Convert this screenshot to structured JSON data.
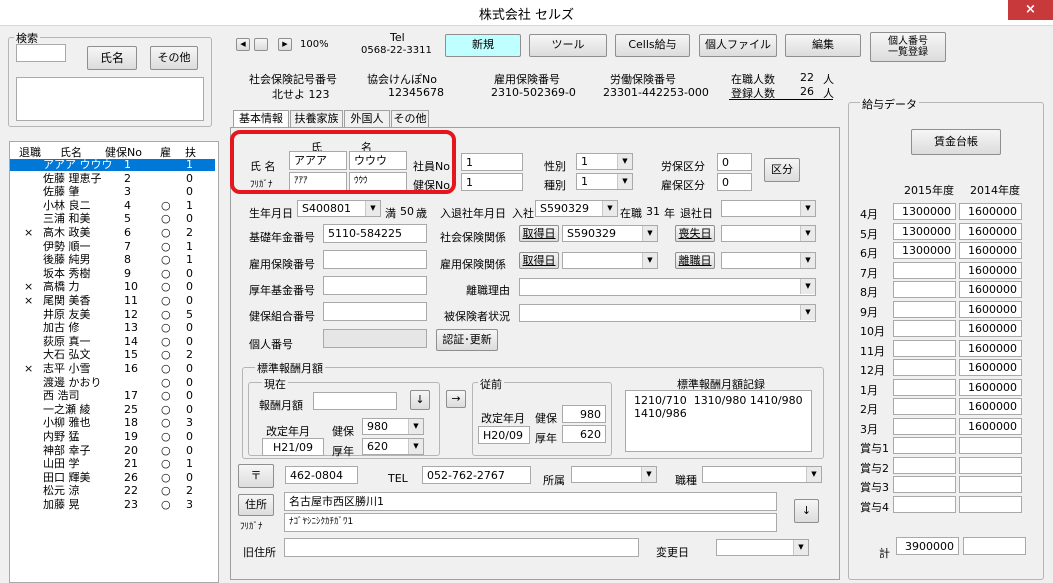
{
  "window": {
    "title": "株式会社 セルズ",
    "close": "×"
  },
  "search": {
    "group_label": "検索",
    "name_button": "氏名",
    "other_button": "その他"
  },
  "nav": {
    "first": "◀",
    "prev": "▏",
    "next": "▶",
    "zoom": "100%"
  },
  "tel": {
    "label": "Tel",
    "number": "0568-22-3311"
  },
  "toolbar": {
    "new": "新規",
    "tool": "ツール",
    "cells": "Cells給与",
    "personal_file": "個人ファイル",
    "edit": "編集",
    "mynumber": "個人番号\n一覧登録"
  },
  "company": {
    "shaho_label": "社会保険記号番号",
    "shaho_value": "北せよ 123",
    "kyokai_label": "協会けんぽNo",
    "kyokai_value": "12345678",
    "koyo_label": "雇用保険番号",
    "koyo_value": "2310-502369-0",
    "rodo_label": "労働保険番号",
    "rodo_value": "23301-442253-000",
    "zaishoku_label": "在職人数",
    "zaishoku_value": "22",
    "zaishoku_unit": "人",
    "toroku_label": "登録人数",
    "toroku_value": "26",
    "toroku_unit": "人"
  },
  "list": {
    "headers": [
      "退職",
      "氏名",
      "健保No",
      "雇",
      "扶"
    ],
    "rows": [
      {
        "retired": "",
        "name": "アアア ウウウ",
        "no": "1",
        "ko": "",
        "fu": "1"
      },
      {
        "retired": "",
        "name": "佐藤 理恵子",
        "no": "2",
        "ko": "",
        "fu": "0"
      },
      {
        "retired": "",
        "name": "佐藤 肇",
        "no": "3",
        "ko": "",
        "fu": "0"
      },
      {
        "retired": "",
        "name": "小林 良二",
        "no": "4",
        "ko": "○",
        "fu": "1"
      },
      {
        "retired": "",
        "name": "三浦 和美",
        "no": "5",
        "ko": "○",
        "fu": "0"
      },
      {
        "retired": "×",
        "name": "高木 政美",
        "no": "6",
        "ko": "○",
        "fu": "2"
      },
      {
        "retired": "",
        "name": "伊勢 順一",
        "no": "7",
        "ko": "○",
        "fu": "1"
      },
      {
        "retired": "",
        "name": "後藤 純男",
        "no": "8",
        "ko": "○",
        "fu": "1"
      },
      {
        "retired": "",
        "name": "坂本 秀樹",
        "no": "9",
        "ko": "○",
        "fu": "0"
      },
      {
        "retired": "×",
        "name": "高橋 力",
        "no": "10",
        "ko": "○",
        "fu": "0"
      },
      {
        "retired": "×",
        "name": "尾関 美香",
        "no": "11",
        "ko": "○",
        "fu": "0"
      },
      {
        "retired": "",
        "name": "井原 友美",
        "no": "12",
        "ko": "○",
        "fu": "5"
      },
      {
        "retired": "",
        "name": "加古 修",
        "no": "13",
        "ko": "○",
        "fu": "0"
      },
      {
        "retired": "",
        "name": "荻原 真一",
        "no": "14",
        "ko": "○",
        "fu": "0"
      },
      {
        "retired": "",
        "name": "大石 弘文",
        "no": "15",
        "ko": "○",
        "fu": "2"
      },
      {
        "retired": "×",
        "name": "志平 小雪",
        "no": "16",
        "ko": "○",
        "fu": "0"
      },
      {
        "retired": "",
        "name": "渡邊 かおり",
        "no": "",
        "ko": "○",
        "fu": "0"
      },
      {
        "retired": "",
        "name": "西 浩司",
        "no": "17",
        "ko": "○",
        "fu": "0"
      },
      {
        "retired": "",
        "name": "一之瀬 綾",
        "no": "25",
        "ko": "○",
        "fu": "0"
      },
      {
        "retired": "",
        "name": "小柳 雅也",
        "no": "18",
        "ko": "○",
        "fu": "3"
      },
      {
        "retired": "",
        "name": "内野 猛",
        "no": "19",
        "ko": "○",
        "fu": "0"
      },
      {
        "retired": "",
        "name": "神部 幸子",
        "no": "20",
        "ko": "○",
        "fu": "0"
      },
      {
        "retired": "",
        "name": "山田 学",
        "no": "21",
        "ko": "○",
        "fu": "1"
      },
      {
        "retired": "",
        "name": "田口 輝美",
        "no": "26",
        "ko": "○",
        "fu": "0"
      },
      {
        "retired": "",
        "name": "松元 涼",
        "no": "22",
        "ko": "○",
        "fu": "2"
      },
      {
        "retired": "",
        "name": "加藤 晃",
        "no": "23",
        "ko": "○",
        "fu": "3"
      }
    ]
  },
  "tabs": [
    "基本情報",
    "扶養家族",
    "外国人",
    "その他"
  ],
  "form": {
    "shi_header": "氏",
    "mei_header": "名",
    "name_label": "氏 名",
    "shi": "アアア",
    "mei": "ウウウ",
    "furi_label": "ﾌﾘｶﾞﾅ",
    "furi_shi": "ｱｱｱ",
    "furi_mei": "ｳｳｳ",
    "shain_label": "社員No",
    "shain_value": "1",
    "kenpo_label": "健保No",
    "kenpo_value": "1",
    "seibetsu_label": "性別",
    "seibetsu_value": "1",
    "shubetsu_label": "種別",
    "shubetsu_value": "1",
    "rouho_label": "労保区分",
    "rouho_value": "0",
    "koyo_label": "雇保区分",
    "koyo_value": "0",
    "kubun_button": "区分",
    "birth_label": "生年月日",
    "birth_value": "S400801",
    "age_prefix": "満",
    "age": "50",
    "age_unit": "歳",
    "nyutai_label": "入退社年月日",
    "nyusha_label": "入社",
    "nyusha_value": "S590329",
    "zaisha_label": "在職",
    "zaisha_value": "31",
    "zaisha_unit": "年",
    "taisha_label": "退社日",
    "taisha_value": "",
    "kiso_label": "基礎年金番号",
    "kiso_value": "5110-584225",
    "shaho_kankei_label": "社会保険関係",
    "shutoku_button": "取得日",
    "shaho_shutoku_value": "S590329",
    "soshitsu_button": "喪失日",
    "koyo_no_label": "雇用保険番号",
    "koyo_no_value": "",
    "koyo_kankei_label": "雇用保険関係",
    "koyo_shutoku_button": "取得日",
    "rishoku_button": "離職日",
    "kosei_label": "厚年基金番号",
    "rishoku_riyu_label": "離職理由",
    "kumiai_label": "健保組合番号",
    "hihoken_label": "被保険者状況",
    "kojin_label": "個人番号",
    "ninsho_button": "認証･更新"
  },
  "hyojun": {
    "title": "標準報酬月額",
    "current_label": "現在",
    "monthly_label": "報酬月額",
    "monthly_value": "",
    "arrow_down": "↓",
    "arrow_right": "→",
    "kaitei_label": "改定年月",
    "kenpo_label": "健保",
    "kenpo_value": "980",
    "kaitei_value": "H21/09",
    "kounen_label": "厚年",
    "kounen_value": "620",
    "prev_label": "従前",
    "prev_kaitei_label": "改定年月",
    "prev_kenpo_label": "健保",
    "prev_kenpo_value": "980",
    "prev_kaitei_value": "H20/09",
    "prev_kounen_label": "厚年",
    "prev_kounen_value": "620",
    "record_title": "標準報酬月額記録",
    "record_text": "1210/710  1310/980 1410/980\n1410/986"
  },
  "address": {
    "zip_button": "〒",
    "zip_value": "462-0804",
    "tel_label": "TEL",
    "tel_value": "052-762-2767",
    "shozoku_label": "所属",
    "shokushu_label": "職種",
    "jusho_button": "住所",
    "jusho_value": "名古屋市西区勝川1",
    "furi_label": "ﾌﾘｶﾞﾅ",
    "furi_value": "ﾅｺﾞﾔｼﾆｼｸｶﾁｶﾞﾜ1",
    "down_button": "↓",
    "old_label": "旧住所",
    "old_value": "",
    "henko_label": "変更日"
  },
  "salary": {
    "group_label": "給与データ",
    "ledger_button": "賃金台帳",
    "year1": "2015年度",
    "year2": "2014年度",
    "rows": [
      {
        "label": "4月",
        "a": "1300000",
        "b": "1600000"
      },
      {
        "label": "5月",
        "a": "1300000",
        "b": "1600000"
      },
      {
        "label": "6月",
        "a": "1300000",
        "b": "1600000"
      },
      {
        "label": "7月",
        "a": "",
        "b": "1600000"
      },
      {
        "label": "8月",
        "a": "",
        "b": "1600000"
      },
      {
        "label": "9月",
        "a": "",
        "b": "1600000"
      },
      {
        "label": "10月",
        "a": "",
        "b": "1600000"
      },
      {
        "label": "11月",
        "a": "",
        "b": "1600000"
      },
      {
        "label": "12月",
        "a": "",
        "b": "1600000"
      },
      {
        "label": "1月",
        "a": "",
        "b": "1600000"
      },
      {
        "label": "2月",
        "a": "",
        "b": "1600000"
      },
      {
        "label": "3月",
        "a": "",
        "b": "1600000"
      },
      {
        "label": "賞与1",
        "a": "",
        "b": ""
      },
      {
        "label": "賞与2",
        "a": "",
        "b": ""
      },
      {
        "label": "賞与3",
        "a": "",
        "b": ""
      },
      {
        "label": "賞与4",
        "a": "",
        "b": ""
      }
    ],
    "total_label": "計",
    "total_a": "3900000",
    "total_b": ""
  }
}
